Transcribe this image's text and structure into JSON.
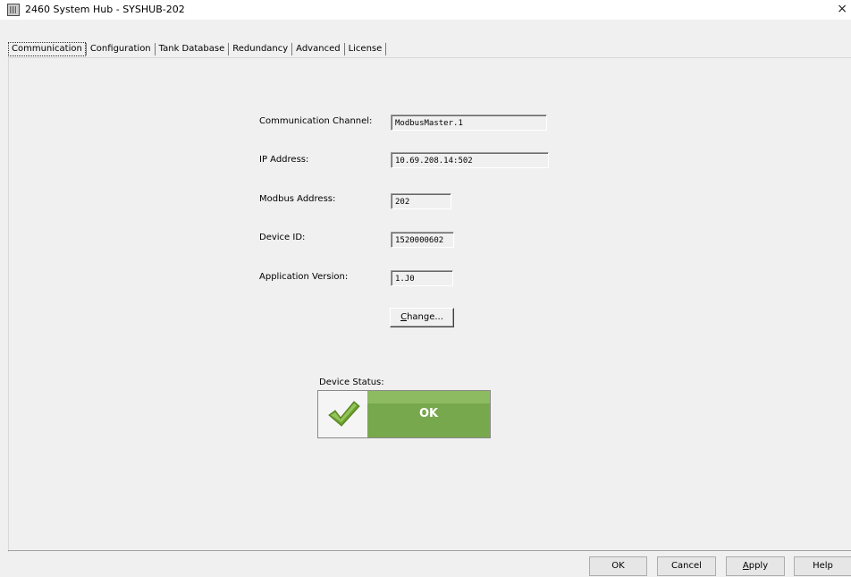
{
  "window": {
    "title": "2460 System Hub  - SYSHUB-202",
    "icon": "app-grid-icon",
    "close_glyph": "×"
  },
  "tabs": [
    {
      "label": "Communication",
      "active": true
    },
    {
      "label": "Configuration",
      "active": false
    },
    {
      "label": "Tank Database",
      "active": false
    },
    {
      "label": "Redundancy",
      "active": false
    },
    {
      "label": "Advanced",
      "active": false
    },
    {
      "label": "License",
      "active": false
    }
  ],
  "form": {
    "channel": {
      "label": "Communication Channel:",
      "value": "ModbusMaster.1"
    },
    "ip": {
      "label": "IP Address:",
      "value": "10.69.208.14:502"
    },
    "modbus": {
      "label": "Modbus Address:",
      "value": "202"
    },
    "device_id": {
      "label": "Device ID:",
      "value": "1520000602"
    },
    "app_version": {
      "label": "Application Version:",
      "value": "1.J0"
    },
    "change_button": {
      "accel": "C",
      "rest": "hange..."
    }
  },
  "status": {
    "label": "Device Status:",
    "value": "OK",
    "icon": "checkmark-icon",
    "color": "#78a84e"
  },
  "buttons": {
    "ok": "OK",
    "cancel": "Cancel",
    "apply_accel": "A",
    "apply_rest": "pply",
    "help": "Help"
  }
}
